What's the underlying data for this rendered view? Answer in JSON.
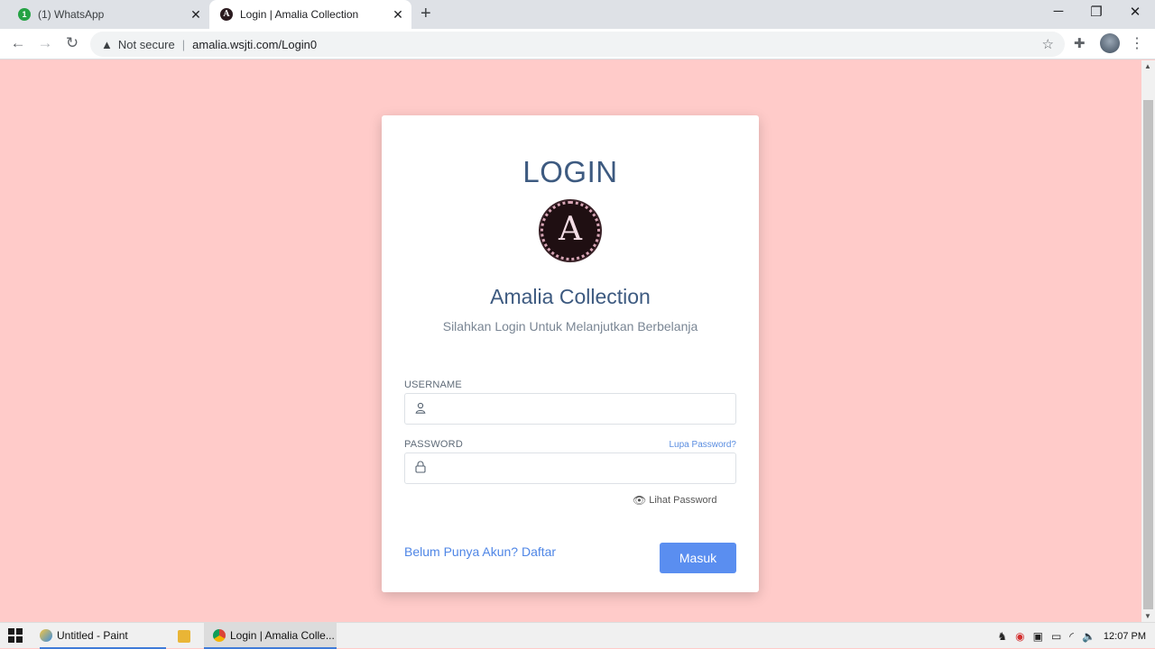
{
  "browser": {
    "tabs": [
      {
        "title": "(1) WhatsApp",
        "badge": "1"
      },
      {
        "title": "Login | Amalia Collection",
        "badge": "A"
      }
    ],
    "address": {
      "security": "Not secure",
      "url": "amalia.wsjti.com/Login0"
    }
  },
  "page": {
    "title": "LOGIN",
    "logo_letter": "A",
    "brand": "Amalia Collection",
    "subtitle": "Silahkan Login Untuk Melanjutkan Berbelanja",
    "username_label": "USERNAME",
    "password_label": "PASSWORD",
    "forgot_password": "Lupa Password?",
    "show_password": "Lihat Password",
    "register_link": "Belum Punya Akun? Daftar",
    "submit": "Masuk"
  },
  "taskbar": {
    "items": [
      {
        "label": "Untitled - Paint"
      },
      {
        "label": "Login | Amalia Colle..."
      }
    ],
    "clock": "12:07 PM"
  },
  "colors": {
    "page_background": "#ffcbc9",
    "heading": "#3d5a80",
    "button": "#5a8ef0",
    "link": "#4f86e6"
  }
}
